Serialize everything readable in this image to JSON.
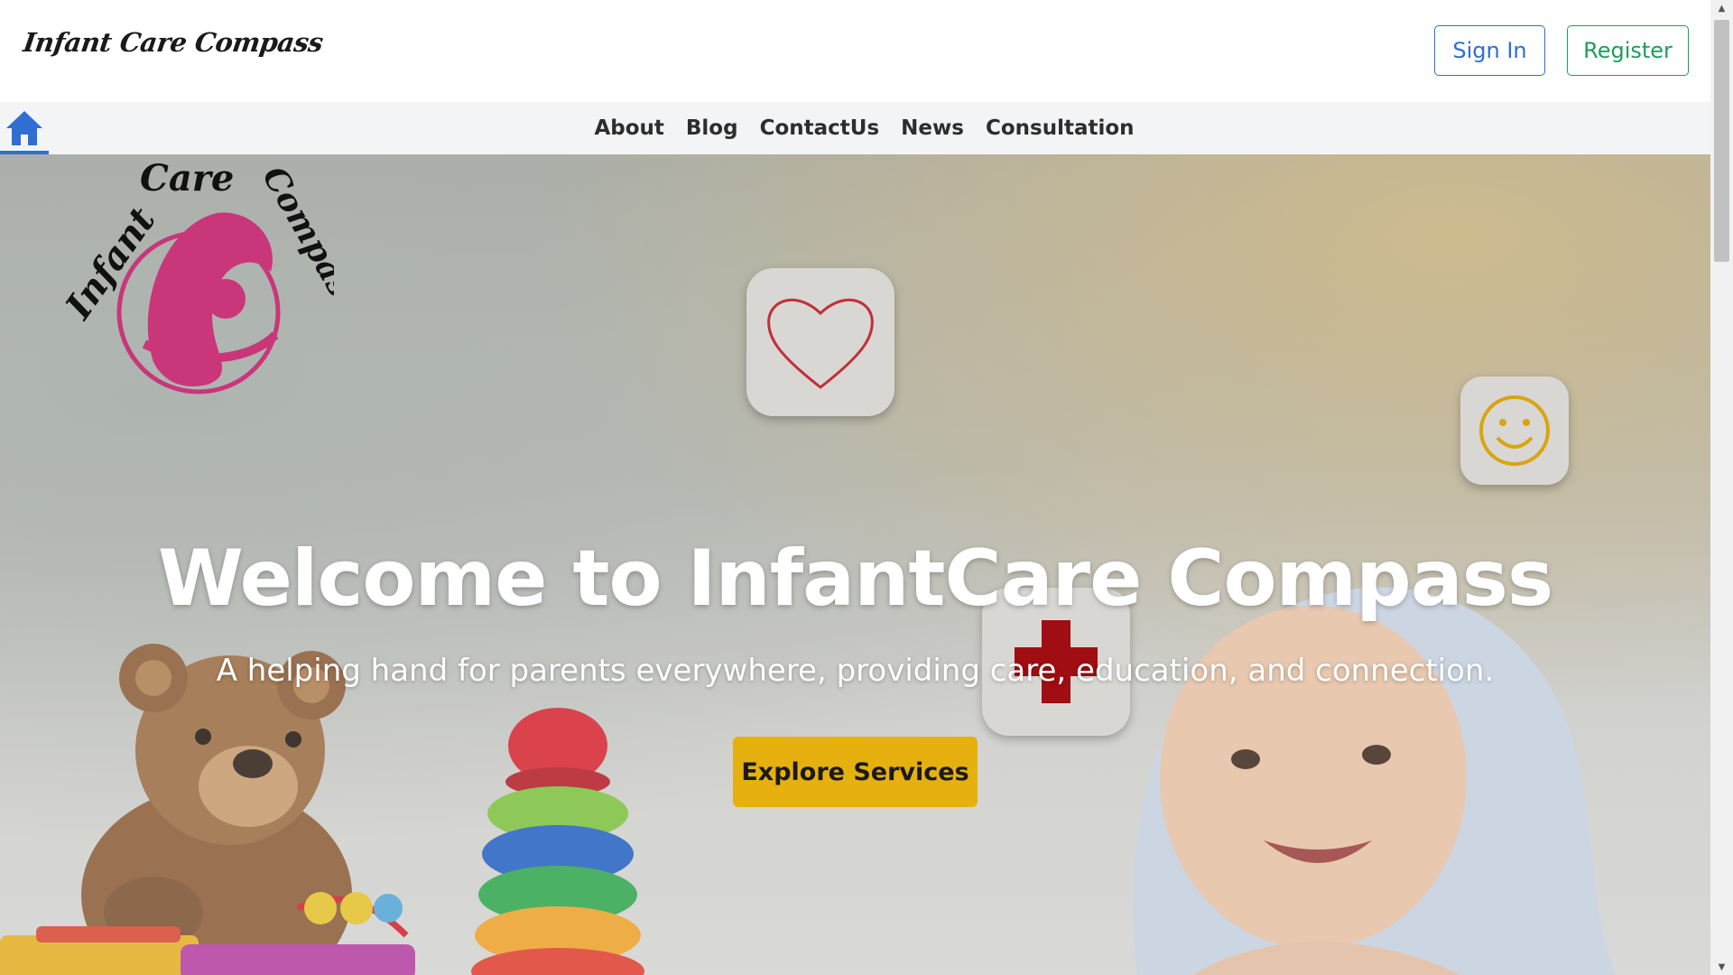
{
  "header": {
    "brand": "Infant Care Compass",
    "sign_in_label": "Sign In",
    "register_label": "Register"
  },
  "nav": {
    "home_icon": "home-icon",
    "items": [
      {
        "label": "About"
      },
      {
        "label": "Blog"
      },
      {
        "label": "ContactUs"
      },
      {
        "label": "News"
      },
      {
        "label": "Consultation"
      }
    ]
  },
  "hero": {
    "logo_text": "Infant Care Compass",
    "title": "Welcome to InfantCare Compass",
    "subtitle": "A helping hand for parents everywhere, providing care, education, and connection.",
    "cta_label": "Explore Services",
    "icons": [
      "heart-icon",
      "smile-icon",
      "medical-cross-icon"
    ]
  },
  "colors": {
    "accent_blue": "#2f6fd1",
    "register_green": "#1f9d5a",
    "cta_yellow": "#e6b00f",
    "logo_pink": "#c9367a",
    "heart_red": "#c0303a",
    "cross_red": "#a00d12",
    "smile_gold": "#d9a40f"
  }
}
